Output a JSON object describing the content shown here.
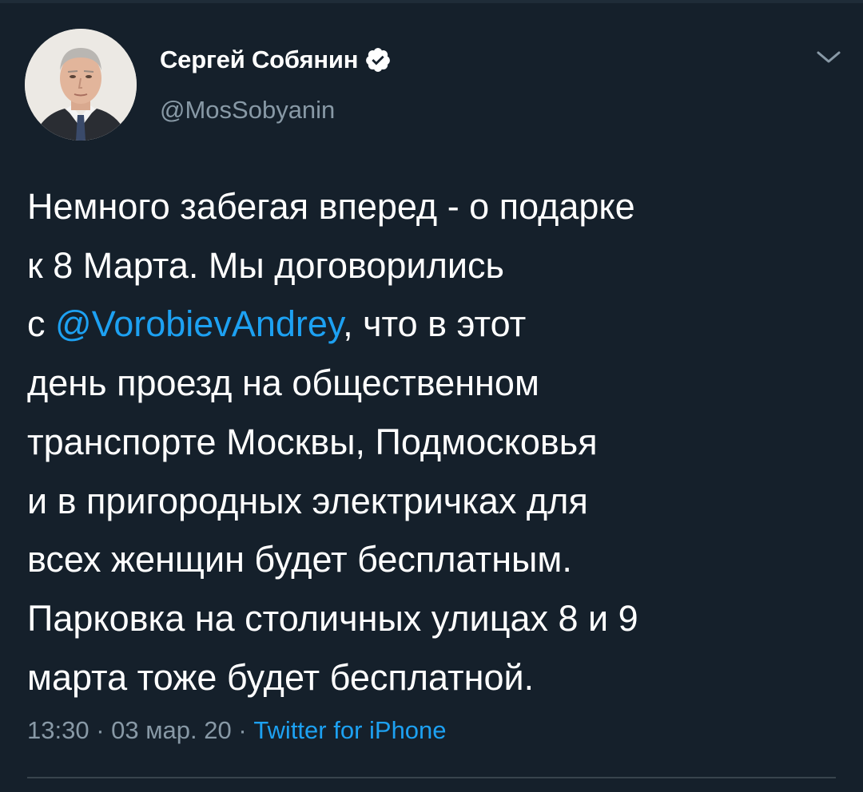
{
  "tweet": {
    "author": {
      "display_name": "Сергей Собянин",
      "handle": "@MosSobyanin",
      "verified": true,
      "avatar": "profile-photo"
    },
    "menu_icon": "chevron-down-icon",
    "text_lines": {
      "l1": "Немного забегая вперед - о подарке",
      "l2": "к 8 Марта. Мы договорились",
      "l3_pre": "с ",
      "l3_mention": "@VorobievAndrey",
      "l3_post": ", что в этот",
      "l4": "день проезд на общественном",
      "l5": "транспорте Москвы, Подмосковья",
      "l6": "и в пригородных электричках для",
      "l7": "всех женщин будет бесплатным.",
      "l8": "Парковка на столичных улицах 8 и 9",
      "l9": "марта тоже будет бесплатной."
    },
    "meta": {
      "time": "13:30",
      "sep1": " · ",
      "date": "03 мар. 20",
      "sep2": " · ",
      "source": "Twitter for iPhone"
    }
  },
  "colors": {
    "background": "#15202b",
    "text": "#ffffff",
    "secondary_text": "#8899a6",
    "link": "#1da1f2",
    "divider": "#38444d"
  }
}
